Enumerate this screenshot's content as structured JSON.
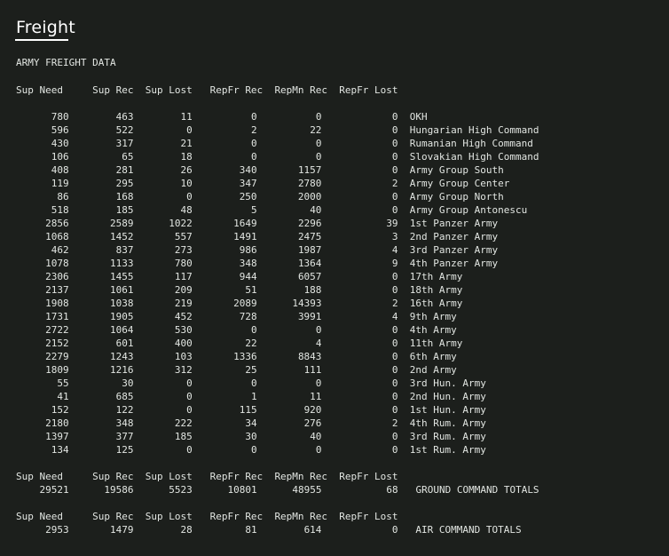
{
  "window": {
    "title": "Freight"
  },
  "report": {
    "heading": "ARMY FREIGHT DATA",
    "columns": [
      "Sup Need",
      "Sup Rec",
      "Sup Lost",
      "RepFr Rec",
      "RepMn Rec",
      "RepFr Lost"
    ],
    "rows": [
      {
        "sup_need": "780",
        "sup_rec": "463",
        "sup_lost": "11",
        "repfr_rec": "0",
        "repmn_rec": "0",
        "repfr_lost": "0",
        "unit": "OKH"
      },
      {
        "sup_need": "596",
        "sup_rec": "522",
        "sup_lost": "0",
        "repfr_rec": "2",
        "repmn_rec": "22",
        "repfr_lost": "0",
        "unit": "Hungarian High Command"
      },
      {
        "sup_need": "430",
        "sup_rec": "317",
        "sup_lost": "21",
        "repfr_rec": "0",
        "repmn_rec": "0",
        "repfr_lost": "0",
        "unit": "Rumanian High Command"
      },
      {
        "sup_need": "106",
        "sup_rec": "65",
        "sup_lost": "18",
        "repfr_rec": "0",
        "repmn_rec": "0",
        "repfr_lost": "0",
        "unit": "Slovakian High Command"
      },
      {
        "sup_need": "408",
        "sup_rec": "281",
        "sup_lost": "26",
        "repfr_rec": "340",
        "repmn_rec": "1157",
        "repfr_lost": "0",
        "unit": "Army Group South"
      },
      {
        "sup_need": "119",
        "sup_rec": "295",
        "sup_lost": "10",
        "repfr_rec": "347",
        "repmn_rec": "2780",
        "repfr_lost": "2",
        "unit": "Army Group Center"
      },
      {
        "sup_need": "86",
        "sup_rec": "168",
        "sup_lost": "0",
        "repfr_rec": "250",
        "repmn_rec": "2000",
        "repfr_lost": "0",
        "unit": "Army Group North"
      },
      {
        "sup_need": "518",
        "sup_rec": "185",
        "sup_lost": "48",
        "repfr_rec": "5",
        "repmn_rec": "40",
        "repfr_lost": "0",
        "unit": "Army Group Antonescu"
      },
      {
        "sup_need": "2856",
        "sup_rec": "2589",
        "sup_lost": "1022",
        "repfr_rec": "1649",
        "repmn_rec": "2296",
        "repfr_lost": "39",
        "unit": "1st Panzer Army"
      },
      {
        "sup_need": "1068",
        "sup_rec": "1452",
        "sup_lost": "557",
        "repfr_rec": "1491",
        "repmn_rec": "2475",
        "repfr_lost": "3",
        "unit": "2nd Panzer Army"
      },
      {
        "sup_need": "462",
        "sup_rec": "837",
        "sup_lost": "273",
        "repfr_rec": "986",
        "repmn_rec": "1987",
        "repfr_lost": "4",
        "unit": "3rd Panzer Army"
      },
      {
        "sup_need": "1078",
        "sup_rec": "1133",
        "sup_lost": "780",
        "repfr_rec": "348",
        "repmn_rec": "1364",
        "repfr_lost": "9",
        "unit": "4th Panzer Army"
      },
      {
        "sup_need": "2306",
        "sup_rec": "1455",
        "sup_lost": "117",
        "repfr_rec": "944",
        "repmn_rec": "6057",
        "repfr_lost": "0",
        "unit": "17th Army"
      },
      {
        "sup_need": "2137",
        "sup_rec": "1061",
        "sup_lost": "209",
        "repfr_rec": "51",
        "repmn_rec": "188",
        "repfr_lost": "0",
        "unit": "18th Army"
      },
      {
        "sup_need": "1908",
        "sup_rec": "1038",
        "sup_lost": "219",
        "repfr_rec": "2089",
        "repmn_rec": "14393",
        "repfr_lost": "2",
        "unit": "16th Army"
      },
      {
        "sup_need": "1731",
        "sup_rec": "1905",
        "sup_lost": "452",
        "repfr_rec": "728",
        "repmn_rec": "3991",
        "repfr_lost": "4",
        "unit": "9th Army"
      },
      {
        "sup_need": "2722",
        "sup_rec": "1064",
        "sup_lost": "530",
        "repfr_rec": "0",
        "repmn_rec": "0",
        "repfr_lost": "0",
        "unit": "4th Army"
      },
      {
        "sup_need": "2152",
        "sup_rec": "601",
        "sup_lost": "400",
        "repfr_rec": "22",
        "repmn_rec": "4",
        "repfr_lost": "0",
        "unit": "11th Army"
      },
      {
        "sup_need": "2279",
        "sup_rec": "1243",
        "sup_lost": "103",
        "repfr_rec": "1336",
        "repmn_rec": "8843",
        "repfr_lost": "0",
        "unit": "6th Army"
      },
      {
        "sup_need": "1809",
        "sup_rec": "1216",
        "sup_lost": "312",
        "repfr_rec": "25",
        "repmn_rec": "111",
        "repfr_lost": "0",
        "unit": "2nd Army"
      },
      {
        "sup_need": "55",
        "sup_rec": "30",
        "sup_lost": "0",
        "repfr_rec": "0",
        "repmn_rec": "0",
        "repfr_lost": "0",
        "unit": "3rd Hun. Army"
      },
      {
        "sup_need": "41",
        "sup_rec": "685",
        "sup_lost": "0",
        "repfr_rec": "1",
        "repmn_rec": "11",
        "repfr_lost": "0",
        "unit": "2nd Hun. Army"
      },
      {
        "sup_need": "152",
        "sup_rec": "122",
        "sup_lost": "0",
        "repfr_rec": "115",
        "repmn_rec": "920",
        "repfr_lost": "0",
        "unit": "1st Hun. Army"
      },
      {
        "sup_need": "2180",
        "sup_rec": "348",
        "sup_lost": "222",
        "repfr_rec": "34",
        "repmn_rec": "276",
        "repfr_lost": "2",
        "unit": "4th Rum. Army"
      },
      {
        "sup_need": "1397",
        "sup_rec": "377",
        "sup_lost": "185",
        "repfr_rec": "30",
        "repmn_rec": "40",
        "repfr_lost": "0",
        "unit": "3rd Rum. Army"
      },
      {
        "sup_need": "134",
        "sup_rec": "125",
        "sup_lost": "0",
        "repfr_rec": "0",
        "repmn_rec": "0",
        "repfr_lost": "0",
        "unit": "1st Rum. Army"
      }
    ],
    "totals": [
      {
        "sup_need": "29521",
        "sup_rec": "19586",
        "sup_lost": "5523",
        "repfr_rec": "10801",
        "repmn_rec": "48955",
        "repfr_lost": "68",
        "label": "GROUND COMMAND TOTALS"
      },
      {
        "sup_need": "2953",
        "sup_rec": "1479",
        "sup_lost": "28",
        "repfr_rec": "81",
        "repmn_rec": "614",
        "repfr_lost": "0",
        "label": "AIR COMMAND TOTALS"
      }
    ]
  }
}
